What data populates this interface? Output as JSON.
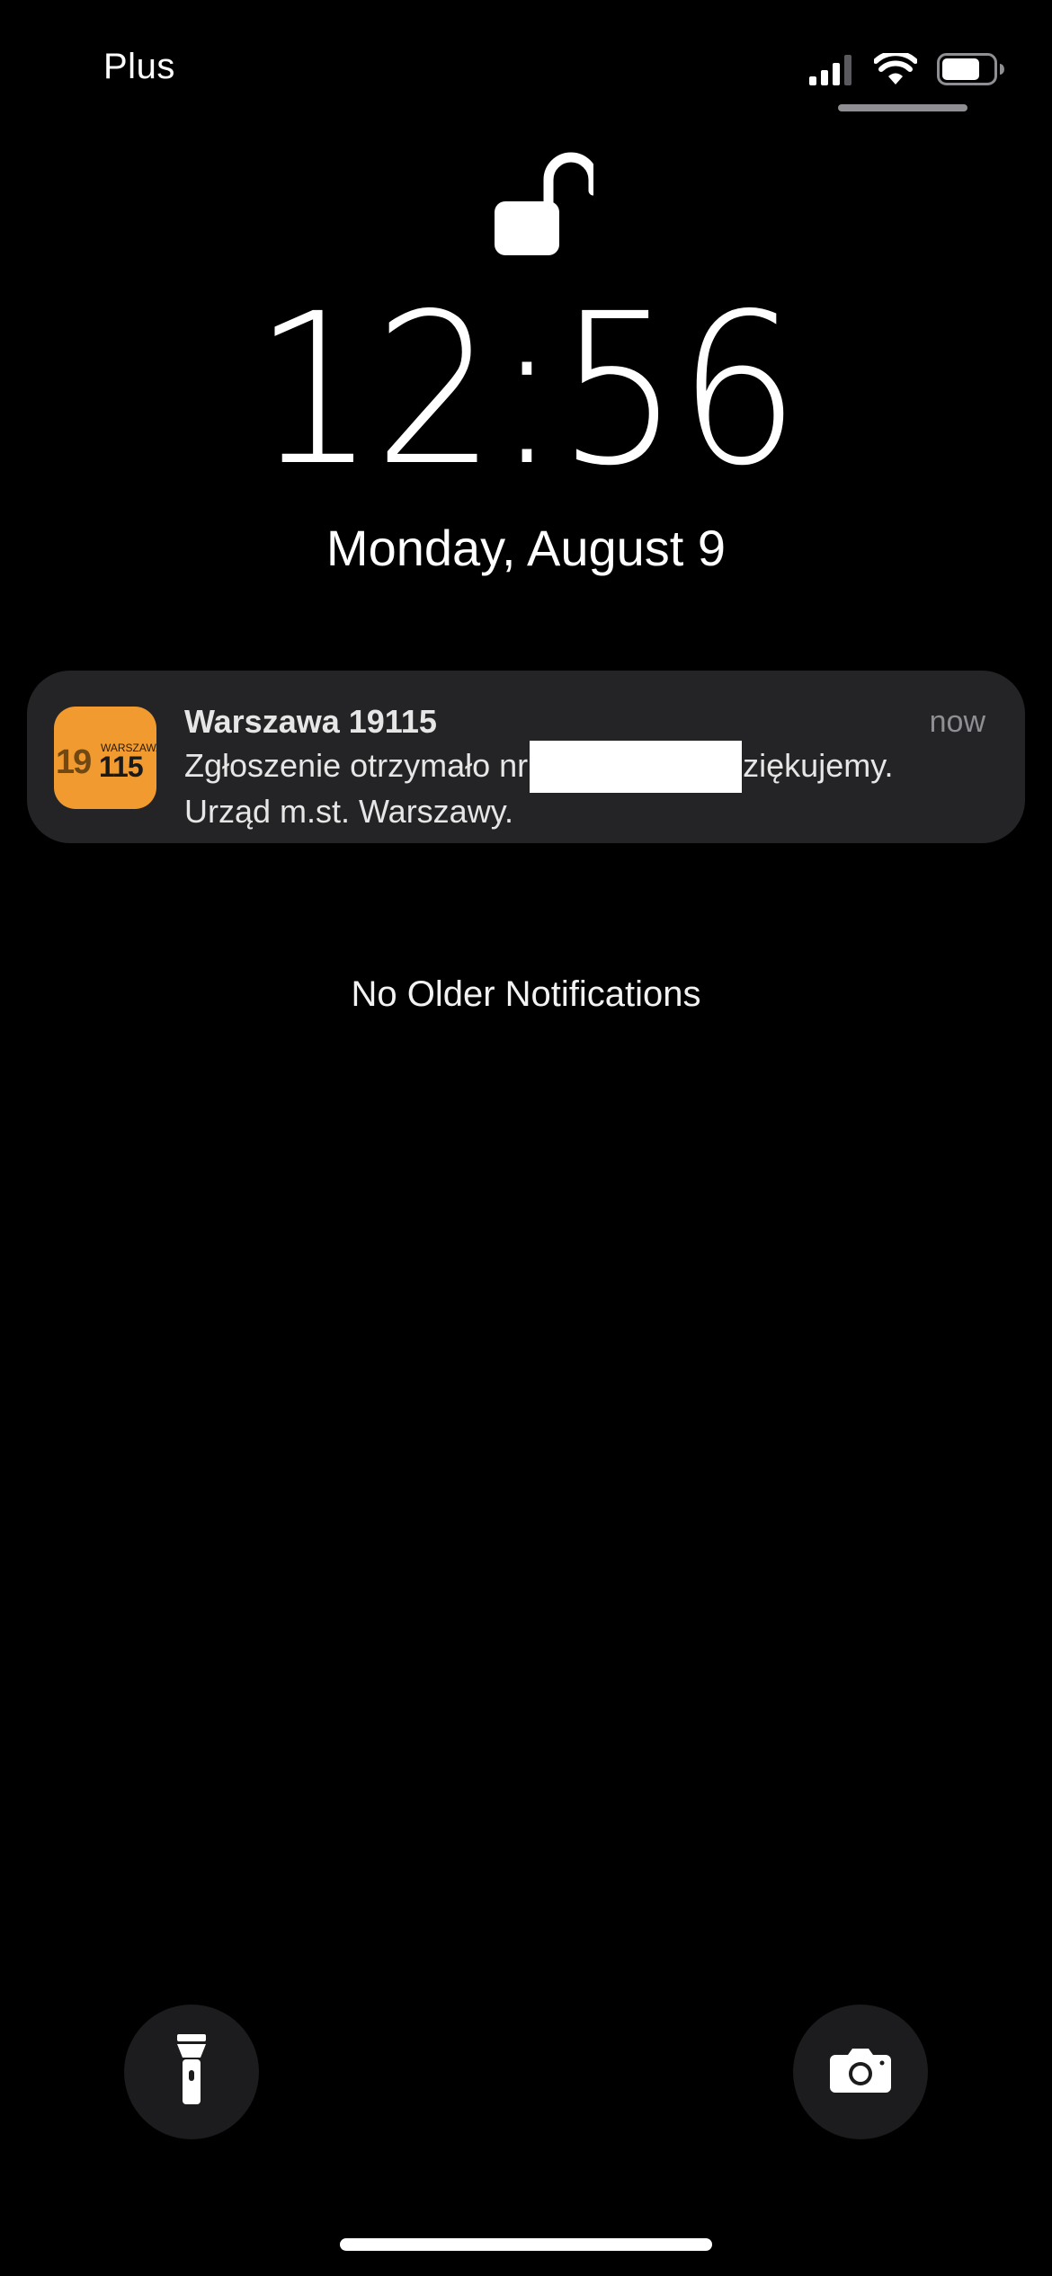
{
  "status_bar": {
    "carrier": "Plus",
    "signal_icon": "cellular-signal-icon",
    "wifi_icon": "wifi-icon",
    "battery_icon": "battery-icon",
    "battery_level": 0.75
  },
  "lock_screen": {
    "lock_icon": "unlocked-padlock-icon",
    "time": "12:56",
    "date": "Monday, August 9"
  },
  "notification": {
    "app_icon": "warszawa-19115-app-icon",
    "app_icon_logo_text": "19 WARSZAWA 115",
    "app_icon_color": "#f19a2f",
    "title": "Warszawa 19115",
    "time": "now",
    "body_line1_start": "Zgłoszenie otrzymało nr",
    "body_line1_end": "ziękujemy.",
    "body_line2": "Urząd m.st. Warszawy."
  },
  "no_older_notifications": "No Older Notifications",
  "bottom_controls": {
    "flashlight_icon": "flashlight-icon",
    "camera_icon": "camera-icon"
  }
}
